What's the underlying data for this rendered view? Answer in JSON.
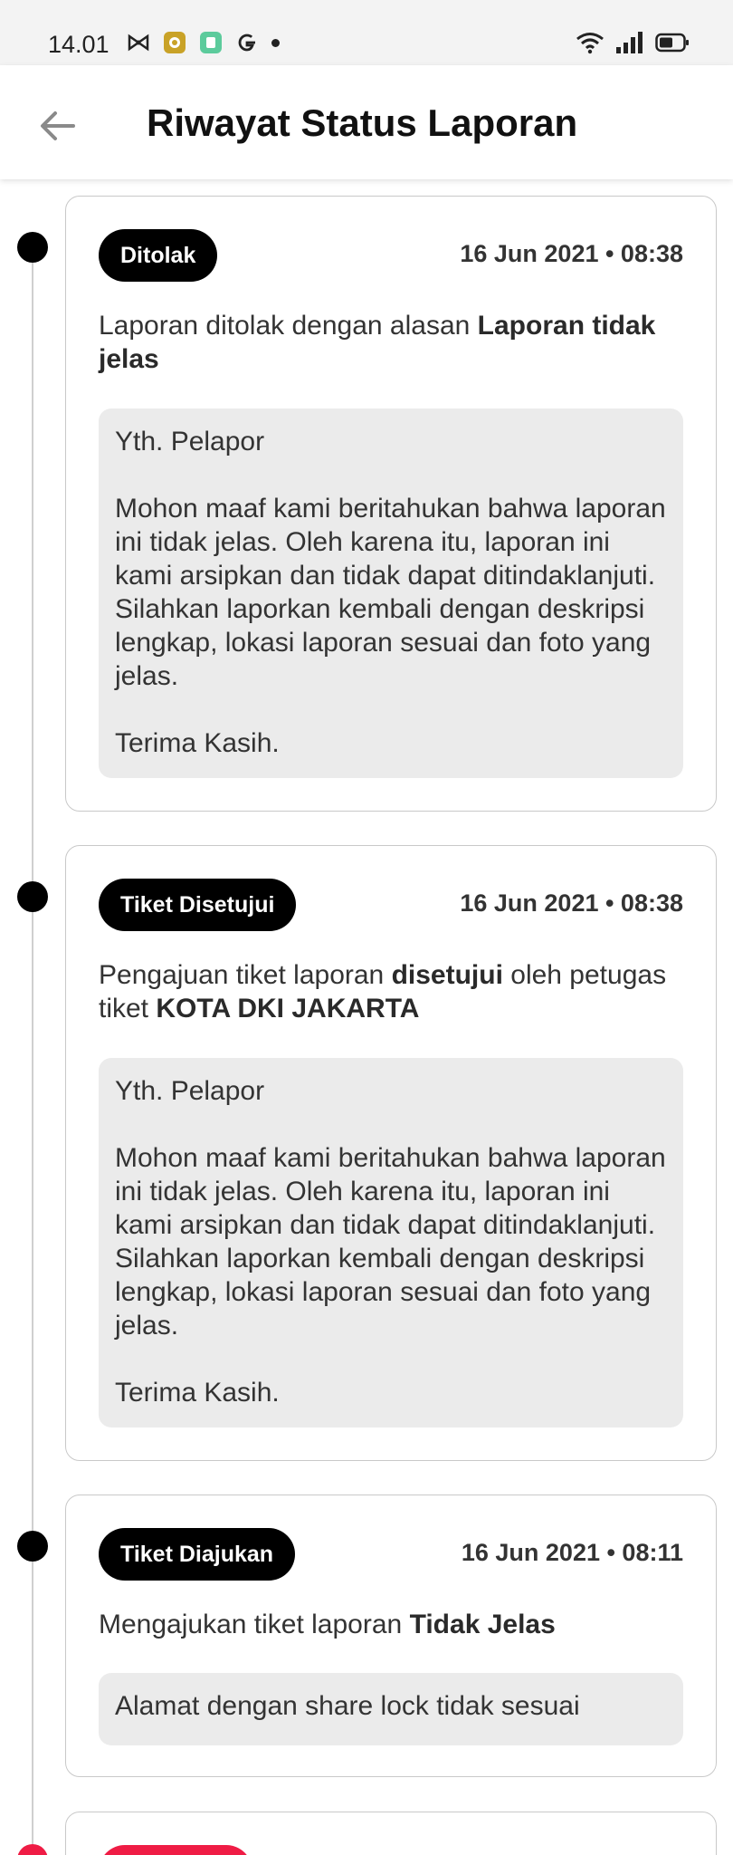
{
  "status_bar": {
    "time": "14.01",
    "left_icons": [
      "bow-icon",
      "coin-icon",
      "app-icon",
      "google-icon"
    ],
    "right_icons": [
      "wifi-icon",
      "signal-icon",
      "battery-icon"
    ]
  },
  "header": {
    "title": "Riwayat Status Laporan"
  },
  "colors": {
    "badge_default": "#000000",
    "badge_rejected_next": "#ef1c45",
    "note_bg": "#ebebeb"
  },
  "history": [
    {
      "status": "Ditolak",
      "timestamp": "16 Jun 2021 • 08:38",
      "desc_prefix": "Laporan ditolak dengan alasan ",
      "desc_bold": "Laporan tidak jelas",
      "note": "Yth. Pelapor\n\nMohon maaf kami beritahukan bahwa laporan ini tidak jelas. Oleh karena itu, laporan ini kami arsipkan dan tidak dapat ditindaklanjuti. Silahkan laporkan kembali dengan deskripsi lengkap, lokasi laporan sesuai dan foto yang jelas.\n\nTerima Kasih."
    },
    {
      "status": "Tiket Disetujui",
      "timestamp": "16 Jun 2021 • 08:38",
      "desc_prefix": "Pengajuan tiket laporan ",
      "desc_bold": "disetujui",
      "desc_middle": " oleh petugas tiket ",
      "desc_bold2": "KOTA DKI JAKARTA",
      "note": "Yth. Pelapor\n\nMohon maaf kami beritahukan bahwa laporan ini tidak jelas. Oleh karena itu, laporan ini kami arsipkan dan tidak dapat ditindaklanjuti. Silahkan laporkan kembali dengan deskripsi lengkap, lokasi laporan sesuai dan foto yang jelas.\n\nTerima Kasih."
    },
    {
      "status": "Tiket Diajukan",
      "timestamp": "16 Jun 2021 • 08:11",
      "desc_prefix": "Mengajukan tiket laporan ",
      "desc_bold": "Tidak Jelas",
      "note": "Alamat dengan share lock tidak sesuai"
    }
  ]
}
